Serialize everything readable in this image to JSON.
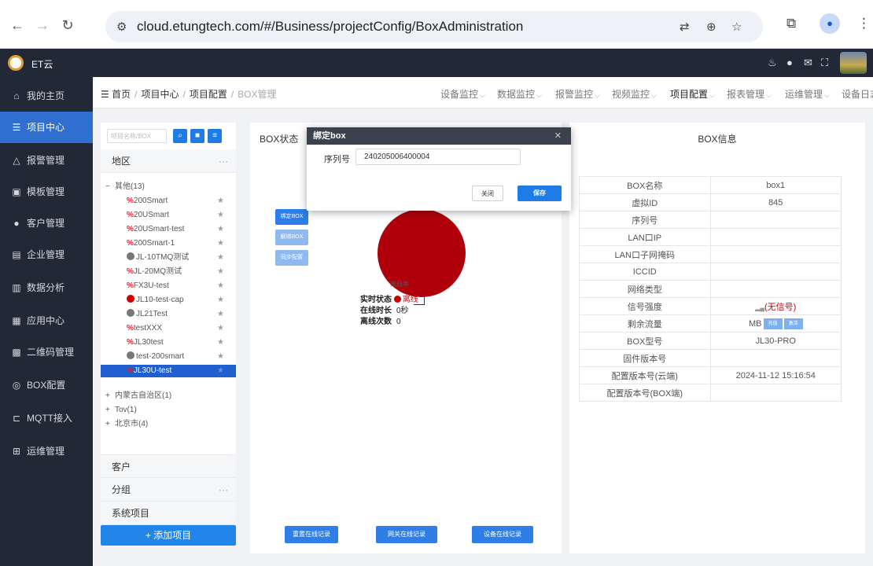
{
  "browser": {
    "url": "cloud.etungtech.com/#/Business/projectConfig/BoxAdministration"
  },
  "topbar": {
    "app_name": "ET云"
  },
  "sidebar": {
    "items": [
      {
        "label": "我的主页",
        "icon": "home-icon"
      },
      {
        "label": "项目中心",
        "icon": "project-icon"
      },
      {
        "label": "报警管理",
        "icon": "bell-icon"
      },
      {
        "label": "模板管理",
        "icon": "template-icon"
      },
      {
        "label": "客户管理",
        "icon": "user-icon"
      },
      {
        "label": "企业管理",
        "icon": "building-icon"
      },
      {
        "label": "数据分析",
        "icon": "chart-icon"
      },
      {
        "label": "应用中心",
        "icon": "grid-icon"
      },
      {
        "label": "二维码管理",
        "icon": "qrcode-icon"
      },
      {
        "label": "BOX配置",
        "icon": "box-icon"
      },
      {
        "label": "MQTT接入",
        "icon": "mqtt-icon"
      },
      {
        "label": "运维管理",
        "icon": "tools-icon"
      }
    ]
  },
  "breadcrumb": {
    "items": [
      "首页",
      "项目中心",
      "项目配置"
    ],
    "current": "BOX管理"
  },
  "header_nav": [
    "设备监控",
    "数据监控",
    "报警监控",
    "视频监控",
    "项目配置",
    "报表管理",
    "运维管理",
    "设备日志"
  ],
  "left_panel": {
    "search_placeholder": "项目名称/BOX",
    "region_title": "地区",
    "group_other": "其他(13)",
    "items": [
      {
        "name": "200Smart",
        "status": "offline-icon"
      },
      {
        "name": "20USmart",
        "status": "offline-icon"
      },
      {
        "name": "20USmart-test",
        "status": "offline-icon"
      },
      {
        "name": "200Smart-1",
        "status": "offline-icon"
      },
      {
        "name": "JL-10TMQ测试",
        "status": "gray"
      },
      {
        "name": "JL-20MQ测试",
        "status": "offline-icon"
      },
      {
        "name": "FX3U-test",
        "status": "offline-icon"
      },
      {
        "name": "JL10-test-cap",
        "status": "red"
      },
      {
        "name": "JL21Test",
        "status": "gray"
      },
      {
        "name": "testXXX",
        "status": "offline-icon"
      },
      {
        "name": "JL30test",
        "status": "offline-icon"
      },
      {
        "name": "test-200smart",
        "status": "gray"
      },
      {
        "name": "JL30U-test",
        "status": "offline-icon"
      }
    ],
    "other_groups": [
      "内蒙古自治区(1)",
      "Tov(1)",
      "北京市(4)"
    ],
    "sections": [
      "客户",
      "分组",
      "系统项目"
    ],
    "add_button": "+ 添加项目"
  },
  "box_status": {
    "title": "BOX状态",
    "buttons": [
      "绑定BOX",
      "解绑BOX",
      "同步配置"
    ],
    "pie_label": "离线率",
    "realtime_label": "实时状态",
    "realtime_value": "离线",
    "online_duration_label": "在线时长",
    "online_duration_value": "0秒",
    "offline_count_label": "离线次数",
    "offline_count_value": "0",
    "bottom_buttons": [
      "重置在线记录",
      "网关在线记录",
      "设备在线记录"
    ]
  },
  "box_info": {
    "title": "BOX信息",
    "rows": [
      {
        "label": "BOX名称",
        "value": "box1"
      },
      {
        "label": "虚拟ID",
        "value": "845"
      },
      {
        "label": "序列号",
        "value": ""
      },
      {
        "label": "LAN口IP",
        "value": ""
      },
      {
        "label": "LAN口子网掩码",
        "value": ""
      },
      {
        "label": "ICCID",
        "value": ""
      },
      {
        "label": "网络类型",
        "value": ""
      },
      {
        "label": "信号强度",
        "value": "(无信号)"
      },
      {
        "label": "剩余流量",
        "value": "MB"
      },
      {
        "label": "BOX型号",
        "value": "JL30-PRO"
      },
      {
        "label": "固件版本号",
        "value": ""
      },
      {
        "label": "配置版本号(云端)",
        "value": "2024-11-12 15:16:54"
      },
      {
        "label": "配置版本号(BOX端)",
        "value": ""
      }
    ],
    "traffic_tags": [
      "充值",
      "激活"
    ]
  },
  "modal": {
    "title": "绑定box",
    "field_label": "序列号",
    "field_value": "240205006400004",
    "close_label": "关闭",
    "save_label": "保存"
  }
}
